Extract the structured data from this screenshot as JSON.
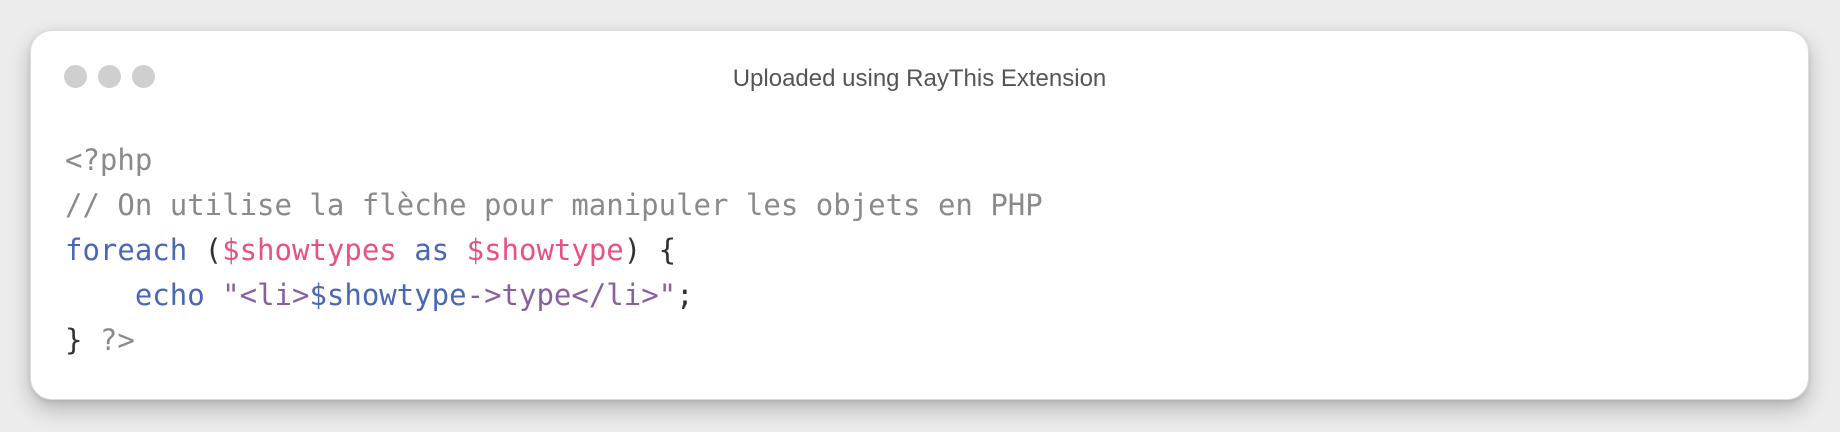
{
  "window": {
    "title": "Uploaded using RayThis Extension"
  },
  "code": {
    "lines": [
      [
        {
          "text": "<?php",
          "type": "gray"
        }
      ],
      [
        {
          "text": "// On utilise la flèche pour manipuler les objets en PHP",
          "type": "gray"
        }
      ],
      [
        {
          "text": "foreach",
          "type": "kw"
        },
        {
          "text": " (",
          "type": "dark"
        },
        {
          "text": "$showtypes",
          "type": "var"
        },
        {
          "text": " ",
          "type": "dark"
        },
        {
          "text": "as",
          "type": "kw"
        },
        {
          "text": " ",
          "type": "dark"
        },
        {
          "text": "$showtype",
          "type": "var"
        },
        {
          "text": ") {",
          "type": "dark"
        }
      ],
      [
        {
          "text": "    ",
          "type": "dark"
        },
        {
          "text": "echo",
          "type": "kw"
        },
        {
          "text": " ",
          "type": "dark"
        },
        {
          "text": "\"<li>",
          "type": "str"
        },
        {
          "text": "$showtype",
          "type": "kw"
        },
        {
          "text": "->type</li>\"",
          "type": "str"
        },
        {
          "text": ";",
          "type": "dark"
        }
      ],
      [
        {
          "text": "} ",
          "type": "dark"
        },
        {
          "text": "?>",
          "type": "gray"
        }
      ]
    ]
  },
  "colors": {
    "comment": "#8a8a8a",
    "keyword": "#4a67b7",
    "variable": "#ea4f86",
    "text": "#333333",
    "string": "#8a5fa0",
    "traffic_light": "#cfcfcf"
  }
}
